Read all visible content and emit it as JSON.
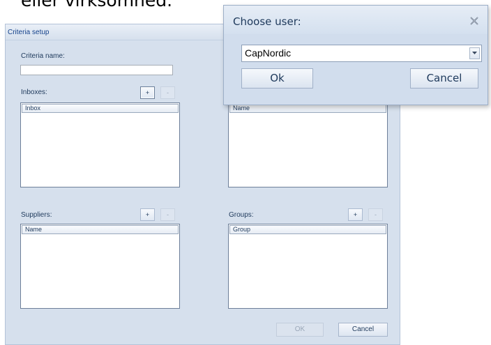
{
  "background": {
    "text": "eller virksomhed."
  },
  "criteria_window": {
    "title": "Criteria setup",
    "criteria_name_label": "Criteria name:",
    "criteria_name_value": "",
    "inboxes": {
      "label": "Inboxes:",
      "add": "+",
      "remove": "-",
      "column": "Inbox"
    },
    "users": {
      "column": "Name"
    },
    "suppliers": {
      "label": "Suppliers:",
      "add": "+",
      "remove": "-",
      "column": "Name"
    },
    "groups": {
      "label": "Groups:",
      "add": "+",
      "remove": "-",
      "column": "Group"
    },
    "ok_label": "OK",
    "cancel_label": "Cancel"
  },
  "choose_user_dialog": {
    "title": "Choose user:",
    "selected_user": "CapNordic",
    "ok_label": "Ok",
    "cancel_label": "Cancel",
    "close_icon": "close-icon"
  },
  "colors": {
    "accent_text": "#1e395b",
    "window_bg": "#d6e0ed"
  }
}
